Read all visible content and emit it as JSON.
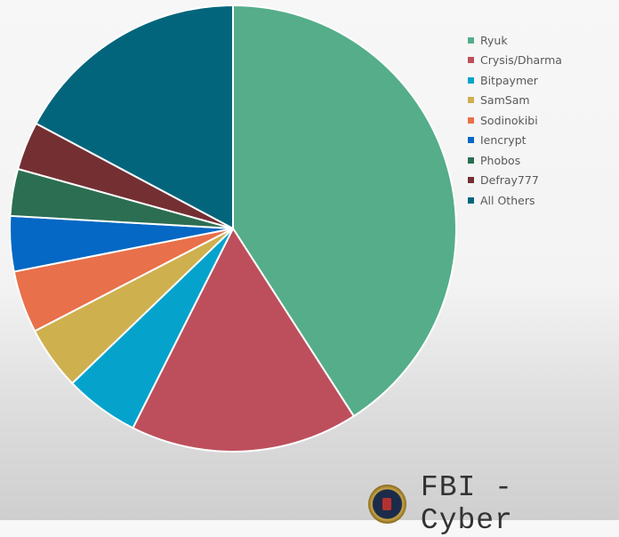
{
  "chart_data": {
    "type": "pie",
    "title": "",
    "start_angle": "top (12 o'clock), clockwise",
    "legend_position": "right",
    "slices": [
      {
        "label": "Ryuk",
        "value": 40.9,
        "color": "#55ad8a"
      },
      {
        "label": "Crysis/Dharma",
        "value": 16.5,
        "color": "#bd4f5c"
      },
      {
        "label": "Bitpaymer",
        "value": 5.4,
        "color": "#05a3cc"
      },
      {
        "label": "SamSam",
        "value": 4.6,
        "color": "#ceb04f"
      },
      {
        "label": "Sodinokibi",
        "value": 4.5,
        "color": "#e8704a"
      },
      {
        "label": "Iencrypt",
        "value": 4.0,
        "color": "#0568c4"
      },
      {
        "label": "Phobos",
        "value": 3.4,
        "color": "#2c6e51"
      },
      {
        "label": "Defray777",
        "value": 3.5,
        "color": "#742f33"
      },
      {
        "label": "All Others",
        "value": 17.2,
        "color": "#03657c"
      }
    ]
  },
  "legend": {
    "items": [
      {
        "label": "Ryuk",
        "color": "#55ad8a"
      },
      {
        "label": "Crysis/Dharma",
        "color": "#bd4f5c"
      },
      {
        "label": "Bitpaymer",
        "color": "#05a3cc"
      },
      {
        "label": "SamSam",
        "color": "#ceb04f"
      },
      {
        "label": "Sodinokibi",
        "color": "#e8704a"
      },
      {
        "label": "Iencrypt",
        "color": "#0568c4"
      },
      {
        "label": "Phobos",
        "color": "#2c6e51"
      },
      {
        "label": "Defray777",
        "color": "#742f33"
      },
      {
        "label": "All Others",
        "color": "#03657c"
      }
    ]
  },
  "branding": {
    "logo_icon": "fbi-seal-icon",
    "text": "FBI - Cyber"
  }
}
